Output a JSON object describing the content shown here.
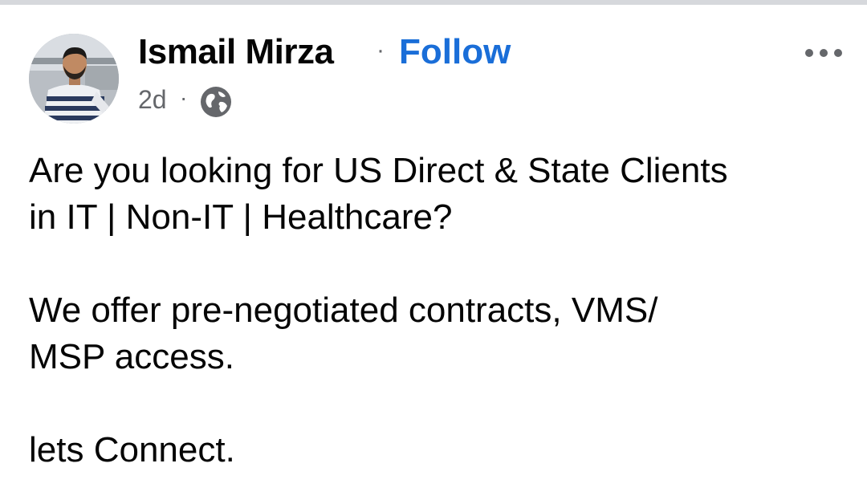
{
  "post": {
    "author": {
      "name": "Ismail Mirza",
      "separator": "·",
      "follow_label": "Follow",
      "avatar_icon": "profile-photo"
    },
    "meta": {
      "time": "2d",
      "separator": "·",
      "audience_icon": "globe-icon"
    },
    "more_icon": "ellipsis-icon",
    "body": {
      "line1": "Are you looking for US Direct & State Clients",
      "line2": "in IT | Non-IT | Healthcare?",
      "line3": "We offer pre-negotiated contracts, VMS/",
      "line4": "MSP access.",
      "line5": "lets Connect."
    }
  },
  "colors": {
    "text": "#050505",
    "secondary": "#65676b",
    "link": "#1a6ed8",
    "divider": "#d6d8dc"
  }
}
